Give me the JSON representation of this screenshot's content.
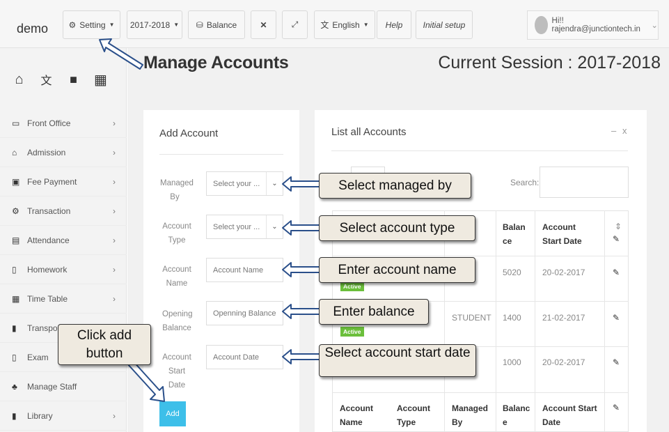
{
  "topbar": {
    "brand": "demo",
    "setting": "Setting",
    "session": "2017-2018",
    "balance": "Balance",
    "language": "English",
    "help": "Help",
    "initial_setup": "Initial setup",
    "user": "Hi!! rajendra@junctiontech.in"
  },
  "page": {
    "title": "Manage Accounts",
    "session_label": "Current Session : 2017-2018"
  },
  "sidebar": {
    "items": [
      {
        "label": "Front Office",
        "icon": "monitor-icon",
        "chevron": "›"
      },
      {
        "label": "Admission",
        "icon": "graduation-cap-icon",
        "chevron": "›"
      },
      {
        "label": "Fee Payment",
        "icon": "money-icon",
        "chevron": "›"
      },
      {
        "label": "Transaction",
        "icon": "gear-icon",
        "chevron": "›"
      },
      {
        "label": "Attendance",
        "icon": "bar-chart-icon",
        "chevron": "›"
      },
      {
        "label": "Homework",
        "icon": "document-icon",
        "chevron": "›"
      },
      {
        "label": "Time Table",
        "icon": "calendar-icon",
        "chevron": "›"
      },
      {
        "label": "Transport",
        "icon": "bus-icon",
        "chevron": ""
      },
      {
        "label": "Exam",
        "icon": "file-icon",
        "chevron": ""
      },
      {
        "label": "Manage Staff",
        "icon": "users-icon",
        "chevron": ""
      },
      {
        "label": "Library",
        "icon": "book-icon",
        "chevron": "›"
      }
    ]
  },
  "add_account": {
    "title": "Add Account",
    "managed_by": {
      "label": "Managed By",
      "placeholder": "Select your ..."
    },
    "account_type": {
      "label": "Account Type",
      "placeholder": "Select your ..."
    },
    "account_name": {
      "label": "Account Name",
      "placeholder": "Account Name"
    },
    "opening_balance": {
      "label": "Opening Balance",
      "placeholder": "Openning Balance"
    },
    "start_date": {
      "label": "Account Start Date",
      "placeholder": "Account Date"
    },
    "add_button": "Add"
  },
  "list_accounts": {
    "title": "List all Accounts",
    "minimize": "–",
    "close": "x",
    "search_label": "Search:",
    "columns": {
      "name": "Account Name",
      "type": "Account Type",
      "managed": "Managed By",
      "balance_top": "Balan ce",
      "balance_bottom": "Balanc e",
      "start": "Account Start Date"
    },
    "rows": [
      {
        "managed": "ANT",
        "balance": "5020",
        "start": "20-02-2017",
        "status": "Active"
      },
      {
        "managed": "STUDENT",
        "balance": "1400",
        "start": "21-02-2017",
        "status": "Active"
      },
      {
        "managed": "ER",
        "balance": "1000",
        "start": "20-02-2017",
        "status": "Active"
      }
    ]
  },
  "callouts": {
    "managed_by": "Select managed by",
    "account_type": "Select account type",
    "account_name": "Enter account name",
    "balance": "Enter balance",
    "start_date": "Select account start date",
    "add": "Click add button"
  }
}
